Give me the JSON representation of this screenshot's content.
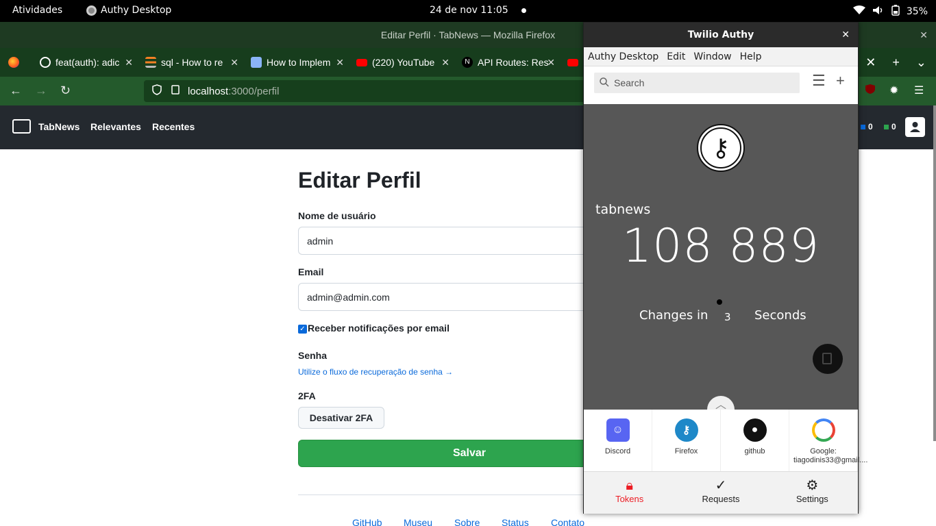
{
  "topbar": {
    "activities": "Atividades",
    "app_name": "Authy Desktop",
    "clock": "24 de nov  11:05",
    "battery": "35%"
  },
  "firefox": {
    "window_title": "Editar Perfil · TabNews — Mozilla Firefox",
    "tabs": [
      {
        "label": "feat(auth): adic",
        "icon": "github-icon",
        "color": "#ffffff"
      },
      {
        "label": "sql - How to re",
        "icon": "stackoverflow-icon",
        "color": "#f48024"
      },
      {
        "label": "How to Implem",
        "icon": "monitor-icon",
        "color": "#8ab4f8"
      },
      {
        "label": "(220) YouTube",
        "icon": "youtube-icon",
        "color": "#ff0000"
      },
      {
        "label": "API Routes: Res",
        "icon": "nextjs-icon",
        "color": "#000000"
      }
    ],
    "url_host": "localhost",
    "url_path": ":3000/perfil"
  },
  "tabnews": {
    "brand": "TabNews",
    "nav_relevantes": "Relevantes",
    "nav_recentes": "Recentes",
    "tabcoins": "0",
    "tabcash": "0"
  },
  "form": {
    "title": "Editar Perfil",
    "username_label": "Nome de usuário",
    "username_value": "admin",
    "email_label": "Email",
    "email_value": "admin@admin.com",
    "notify_label": "Receber notificações por email",
    "password_label": "Senha",
    "recovery_link": "Utilize o fluxo de recuperação de senha →",
    "twofa_label": "2FA",
    "twofa_button": "Desativar 2FA",
    "save_button": "Salvar",
    "notify_checked": true
  },
  "footer": {
    "links": [
      "GitHub",
      "Museu",
      "Sobre",
      "Status",
      "Contato"
    ]
  },
  "authy": {
    "window_title": "Twilio Authy",
    "menu": [
      "Authy Desktop",
      "Edit",
      "Window",
      "Help"
    ],
    "search_placeholder": "Search",
    "token_name": "tabnews",
    "token_code": "108 889",
    "changes_in": "Changes in",
    "seconds_left": "3",
    "seconds": "Seconds",
    "accounts": [
      {
        "label": "Discord",
        "icon": "discord-icon",
        "color": "#5865f2"
      },
      {
        "label": "Firefox",
        "icon": "key-icon",
        "color": "#1e88c8"
      },
      {
        "label": "github",
        "icon": "github-icon",
        "color": "#111111"
      },
      {
        "label": "Google: tiagodinis33@gmail....",
        "icon": "google-icon",
        "color": "#4285f4"
      }
    ],
    "bottom_nav": {
      "tokens": "Tokens",
      "requests": "Requests",
      "settings": "Settings"
    },
    "accent": "#ec1c24"
  }
}
